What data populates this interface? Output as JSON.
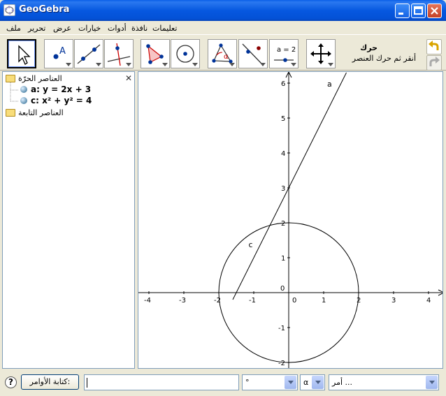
{
  "window": {
    "title": "GeoGebra"
  },
  "menu": {
    "items": [
      "ملف",
      "تحرير",
      "عرض",
      "خيارات",
      "أدوات",
      "نافذة",
      "تعليمات"
    ]
  },
  "toolbar": {
    "tools": [
      "move-tool-icon",
      "point-tool-icon",
      "line-tool-icon",
      "perpendicular-tool-icon",
      "polygon-tool-icon",
      "circle-tool-icon",
      "angle-tool-icon",
      "reflect-tool-icon",
      "slider-tool-icon",
      "move-view-tool-icon"
    ],
    "slider_label": "a = 2",
    "help_title": "حرك",
    "help_text": "أنقر ثم حرك العنصر"
  },
  "algebra": {
    "free_folder": "العناصر الحرّة",
    "dependent_folder": "العناصر التابعة",
    "objects": [
      {
        "name": "a",
        "definition": "a: y = 2x + 3"
      },
      {
        "name": "c",
        "definition": "c: x² + y² = 4"
      }
    ]
  },
  "graphics": {
    "x_ticks": [
      "-4",
      "-3",
      "-2",
      "-1",
      "0",
      "1",
      "2",
      "3",
      "4"
    ],
    "y_ticks": [
      "6",
      "5",
      "4",
      "3",
      "2",
      "1",
      "-1",
      "-2"
    ],
    "origin_label": "0",
    "line_label": "a",
    "circle_label": "c"
  },
  "inputbar": {
    "help_icon": "?",
    "label_button": "كتابة الأوامر:",
    "input_value": "",
    "degree_value": "°",
    "alpha_value": "α",
    "command_value": "أمر ..."
  },
  "colors": {
    "titlebar": "#0658e0",
    "panel_bg": "#ece9d8",
    "selection": "#000000"
  }
}
